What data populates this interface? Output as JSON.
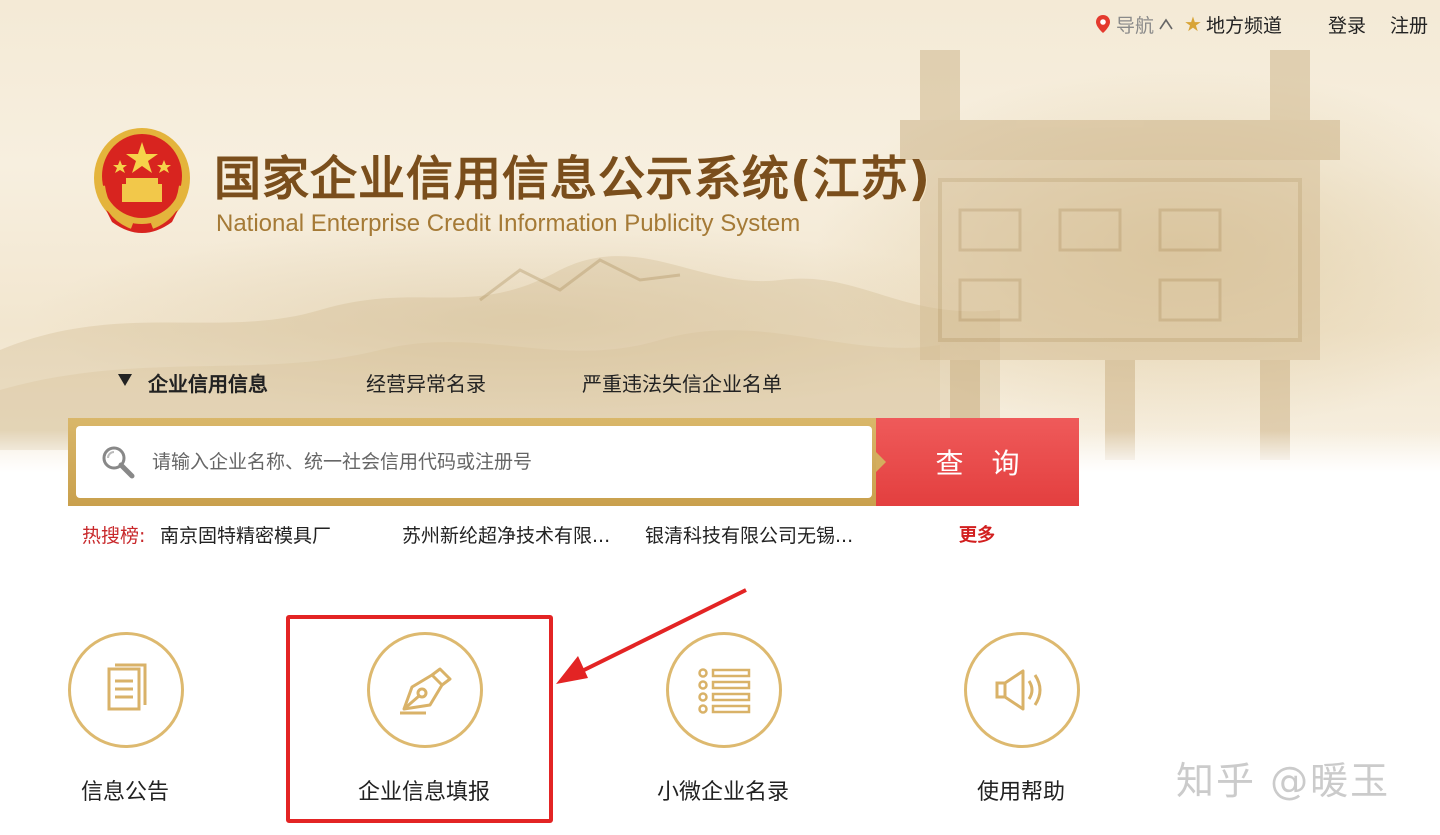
{
  "topbar": {
    "nav_label": "导航",
    "region_label": "地方频道",
    "login_label": "登录",
    "register_label": "注册"
  },
  "header": {
    "title_cn": "国家企业信用信息公示系统(江苏)",
    "title_en": "National Enterprise Credit Information Publicity System"
  },
  "search": {
    "tabs": [
      {
        "label": "企业信用信息",
        "active": true
      },
      {
        "label": "经营异常名录",
        "active": false
      },
      {
        "label": "严重违法失信企业名单",
        "active": false
      }
    ],
    "placeholder": "请输入企业名称、统一社会信用代码或注册号",
    "button_label": "查询"
  },
  "hot_search": {
    "label": "热搜榜:",
    "items": [
      "南京固特精密模具厂",
      "苏州新纶超净技术有限...",
      "银清科技有限公司无锡..."
    ],
    "more_label": "更多"
  },
  "features": [
    {
      "label": "信息公告",
      "icon": "document-icon"
    },
    {
      "label": "企业信息填报",
      "icon": "pen-nib-icon",
      "highlighted": true
    },
    {
      "label": "小微企业名录",
      "icon": "list-icon"
    },
    {
      "label": "使用帮助",
      "icon": "speaker-icon"
    }
  ],
  "watermark": "知乎 @暖玉",
  "colors": {
    "accent_gold": "#ddb96f",
    "search_red": "#e84848",
    "hot_red": "#c8282b",
    "title_brown": "#7a4e1c",
    "highlight_red": "#e32424"
  }
}
